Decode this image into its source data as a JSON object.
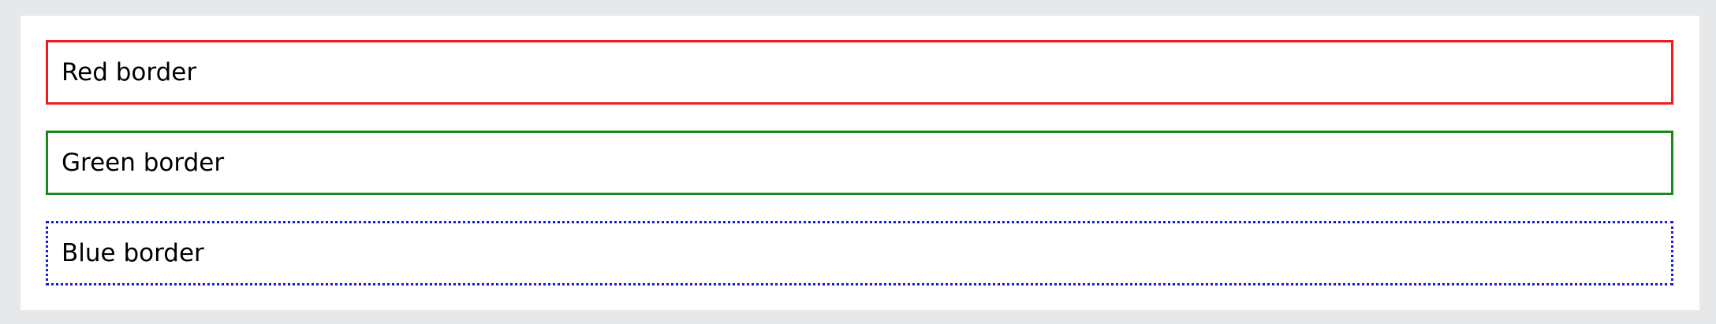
{
  "boxes": [
    {
      "label": "Red border",
      "color": "#ee1c1c",
      "style": "solid"
    },
    {
      "label": "Green border",
      "color": "#1b8a1b",
      "style": "solid"
    },
    {
      "label": "Blue border",
      "color": "#1a1adf",
      "style": "dotted"
    }
  ]
}
